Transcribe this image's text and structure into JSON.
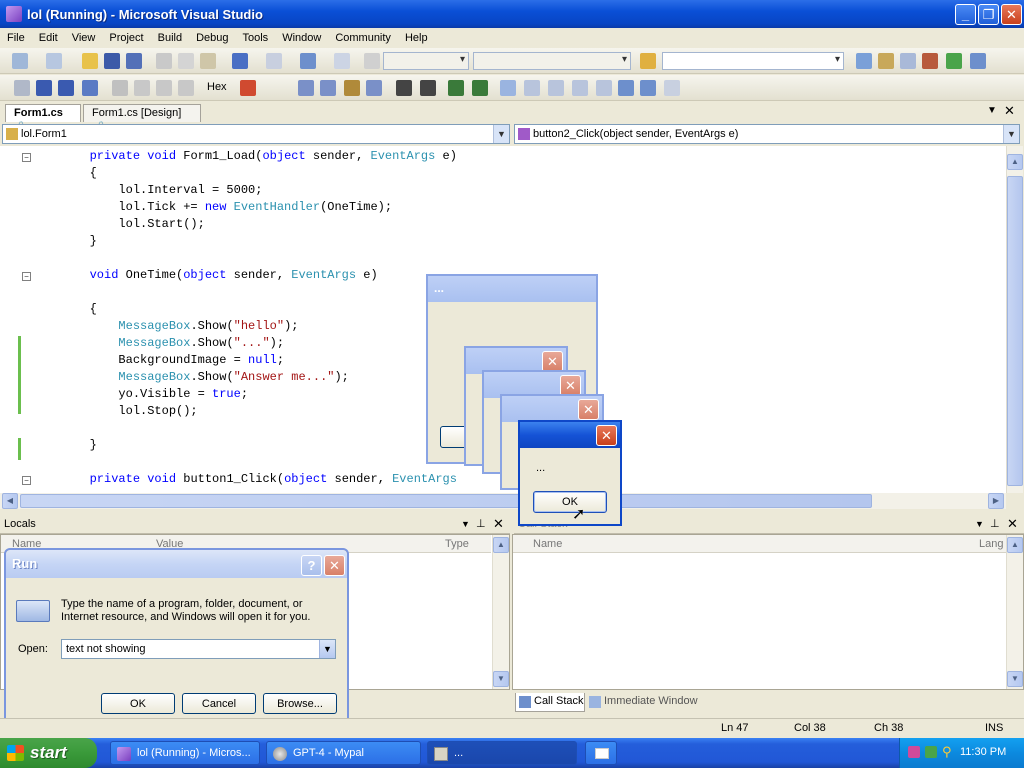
{
  "window": {
    "title": "lol (Running) - Microsoft Visual Studio"
  },
  "menu": [
    "File",
    "Edit",
    "View",
    "Project",
    "Build",
    "Debug",
    "Tools",
    "Window",
    "Community",
    "Help"
  ],
  "toolbar": {
    "hex_label": "Hex"
  },
  "tabs": [
    {
      "label": "Form1.cs"
    },
    {
      "label": "Form1.cs [Design]"
    }
  ],
  "nav": {
    "class_combo": "lol.Form1",
    "member_combo": "button2_Click(object sender, EventArgs e)"
  },
  "code_lines": [
    {
      "t": "        private void Form1_Load(object sender, EventArgs e)"
    },
    {
      "t": "        {"
    },
    {
      "t": "            lol.Interval = 5000;"
    },
    {
      "t": "            lol.Tick += new EventHandler(OneTime);"
    },
    {
      "t": "            lol.Start();"
    },
    {
      "t": "        }"
    },
    {
      "t": ""
    },
    {
      "t": "        void OneTime(object sender, EventArgs e)"
    },
    {
      "t": ""
    },
    {
      "t": "        {"
    },
    {
      "t": "            MessageBox.Show(\"hello\");"
    },
    {
      "t": "            MessageBox.Show(\"...\");"
    },
    {
      "t": "            BackgroundImage = null;"
    },
    {
      "t": "            MessageBox.Show(\"Answer me...\");"
    },
    {
      "t": "            yo.Visible = true;"
    },
    {
      "t": "            lol.Stop();"
    },
    {
      "t": ""
    },
    {
      "t": "        }"
    },
    {
      "t": ""
    },
    {
      "t": "        private void button1_Click(object sender, EventArgs"
    }
  ],
  "locals": {
    "title": "Locals",
    "col_name": "Name",
    "col_value": "Value",
    "col_type": "Type"
  },
  "callstack": {
    "title": "Call Stack",
    "col_name": "Name",
    "col_lang": "Lang"
  },
  "bottom_tabs": {
    "call_stack": "Call Stack",
    "immediate": "Immediate Window"
  },
  "msgbox": {
    "back_title": "...",
    "front_text": "...",
    "ok_label": "OK"
  },
  "run": {
    "title": "Run",
    "help": "?",
    "description": "Type the name of a program, folder, document, or Internet resource, and Windows will open it for you.",
    "open_label": "Open:",
    "open_value": "text not showing",
    "ok": "OK",
    "cancel": "Cancel",
    "browse": "Browse..."
  },
  "status": {
    "ln": "Ln 47",
    "col": "Col 38",
    "ch": "Ch 38",
    "ins": "INS"
  },
  "taskbar": {
    "start": "start",
    "tasks": [
      "lol (Running) - Micros...",
      "GPT-4 - Mypal",
      "..."
    ],
    "time": "11:30 PM"
  },
  "colors": {
    "keyword": "#0000ff",
    "type": "#2b91af",
    "string": "#a31515",
    "xp_blue": "#0a4fd6",
    "change_bar": "#6bbf4e"
  }
}
